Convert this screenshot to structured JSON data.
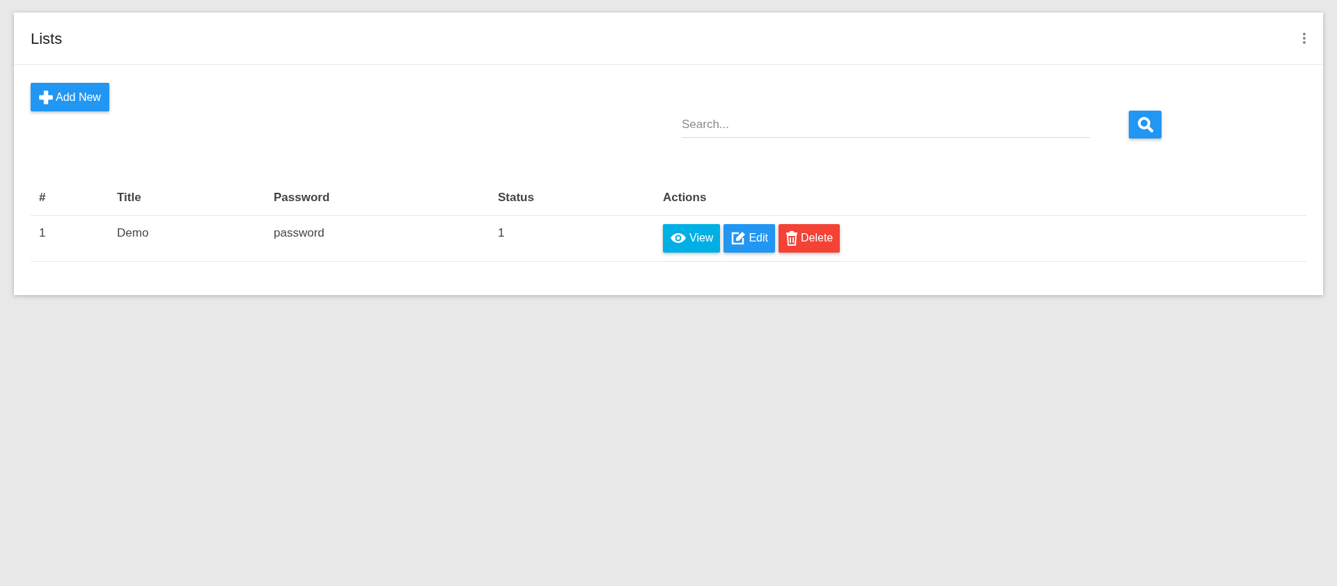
{
  "card": {
    "title": "Lists"
  },
  "add_button": {
    "label": "Add New"
  },
  "search": {
    "placeholder": "Search..."
  },
  "table": {
    "columns": [
      "#",
      "Title",
      "Password",
      "Status",
      "Actions"
    ],
    "rows": [
      {
        "cells": [
          "1",
          "Demo",
          "password",
          "1"
        ],
        "actions": [
          {
            "kind": "view",
            "label": "View",
            "color": "#00b0e4"
          },
          {
            "kind": "edit",
            "label": "Edit",
            "color": "#2196f3"
          },
          {
            "kind": "delete",
            "label": "Delete",
            "color": "#f44336"
          }
        ]
      }
    ]
  }
}
